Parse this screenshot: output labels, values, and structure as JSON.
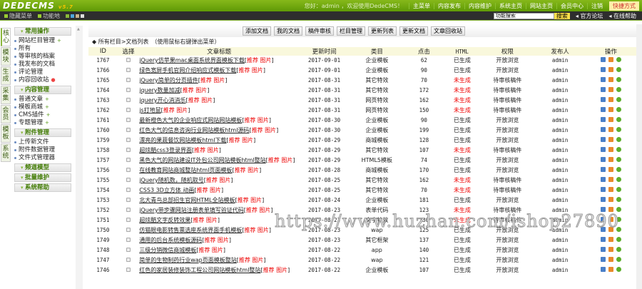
{
  "header": {
    "logo": "DEDECMS",
    "version": "v5.7",
    "welcome": "您好：admin ，欢迎使用DedeCMS！",
    "nav": [
      "主菜单",
      "内容发布",
      "内容维护",
      "系统主页",
      "网站主页",
      "会员中心",
      "注销"
    ],
    "quick": "快捷方式"
  },
  "bar": {
    "hide_menu": "隐藏菜单",
    "func_map": "功能地",
    "search_value": "功能搜索",
    "search_btn": "搜索",
    "forum": "官方论坛",
    "help": "在线帮助",
    "skin_colors": [
      "#8ab83a",
      "#4ea6dc",
      "#c9b28a",
      "#dddddd"
    ]
  },
  "vtabs": [
    "核心",
    "模块",
    "生成",
    "采集",
    "会员",
    "模板",
    "系统"
  ],
  "menu": {
    "g1": "常用操作",
    "g1_items": [
      "网站栏目管理",
      "所有",
      "等审核的档案",
      "我发布的文档",
      "评论管理",
      "内容回收站"
    ],
    "g2": "内容管理",
    "g2_items": [
      "普通文章",
      "模板商城",
      "CMS插件",
      "专题管理"
    ],
    "g3": "附件管理",
    "g3_items": [
      "上传新文件",
      "附件数据管理",
      "文件式管理器"
    ],
    "g4": "频道模型",
    "g5": "批量维护",
    "g6": "系统帮助"
  },
  "toolbar": [
    "添加文档",
    "我的文档",
    "稿件审核",
    "栏目管理",
    "更新列表",
    "更新文档",
    "文章回收站"
  ],
  "crumb": "所有栏目>文档列表　（使用鼠标右键弹出菜单）",
  "columns": [
    "ID",
    "选择",
    "文章标题",
    "更新时间",
    "类目",
    "点击",
    "HTML",
    "权限",
    "发布人",
    "操作"
  ],
  "tags": {
    "open": "[",
    "rec": "推荐",
    "pic": "图片",
    "close": "]"
  },
  "rows": [
    [
      "1767",
      "jQuery仿苹果mac桌面系统界面模板下载",
      "2017-09-01",
      "企业模板",
      "62",
      "已生成",
      "开放浏览",
      "admin"
    ],
    [
      "1766",
      "绿色宽屏手机官网介绍响应式模板下载",
      "2017-09-01",
      "企业模板",
      "90",
      "已生成",
      "开放浏览",
      "admin"
    ],
    [
      "1765",
      "jQuery简单的分页插件",
      "2017-08-31",
      "其它特效",
      "70",
      "未生成",
      "待审核稿件",
      "admin"
    ],
    [
      "1764",
      "jquery数量加减",
      "2017-08-31",
      "其它特效",
      "172",
      "未生成",
      "待审核稿件",
      "admin"
    ],
    [
      "1763",
      "jquery开心消消乐",
      "2017-08-31",
      "网页特效",
      "162",
      "未生成",
      "待审核稿件",
      "admin"
    ],
    [
      "1762",
      "js打地鼠",
      "2017-08-31",
      "网页特效",
      "150",
      "未生成",
      "待审核稿件",
      "admin"
    ],
    [
      "1761",
      "最新橙色大气的企业响应式网站网站模板",
      "2017-08-30",
      "企业模板",
      "90",
      "已生成",
      "开放浏览",
      "admin"
    ],
    [
      "1760",
      "红色大气的信息咨询行业网站模板html源码",
      "2017-08-30",
      "企业模板",
      "199",
      "已生成",
      "开放浏览",
      "admin"
    ],
    [
      "1759",
      "漂亮的果蔬餐饮网站模板html下载",
      "2017-08-29",
      "商城模板",
      "128",
      "已生成",
      "开放浏览",
      "admin"
    ],
    [
      "1758",
      "超炫酷css3登录界面",
      "2017-08-29",
      "其它特效",
      "107",
      "未生成",
      "待审核稿件",
      "admin"
    ],
    [
      "1757",
      "黑色大气的网站建设IT外包公司网站模板html整站",
      "2017-08-29",
      "HTML5模板",
      "74",
      "已生成",
      "开放浏览",
      "admin"
    ],
    [
      "1756",
      "在线教育网站商城整站html页面模板",
      "2017-08-28",
      "商城模板",
      "170",
      "已生成",
      "开放浏览",
      "admin"
    ],
    [
      "1755",
      "jQuery随机数，随机取号",
      "2017-08-25",
      "其它特效",
      "162",
      "未生成",
      "待审核稿件",
      "admin"
    ],
    [
      "1754",
      "CSS3 3D立方体 动画",
      "2017-08-25",
      "其它特效",
      "70",
      "未生成",
      "待审核稿件",
      "admin"
    ],
    [
      "1753",
      "北大青鸟总部招生官网HTML全站模板",
      "2017-08-24",
      "企业模板",
      "181",
      "已生成",
      "开放浏览",
      "admin"
    ],
    [
      "1752",
      "jQuery带步骤网站注册表单填写验证代码",
      "2017-08-23",
      "表单代码",
      "123",
      "未生成",
      "待审核稿件",
      "admin"
    ],
    [
      "1751",
      "超炫酷文字反转效果",
      "2017-08-23",
      "文字特效",
      "130",
      "未生成",
      "待审核稿件",
      "admin"
    ],
    [
      "1750",
      "仿猫眼电影转售票选座系统界面手机模板",
      "2017-08-23",
      "wap",
      "125",
      "已生成",
      "开放浏览",
      "admin"
    ],
    [
      "1749",
      "通用的后台系统模板源码",
      "2017-08-23",
      "其它框架",
      "137",
      "已生成",
      "开放浏览",
      "admin"
    ],
    [
      "1748",
      "三级分销微信商城模板",
      "2017-08-22",
      "app",
      "140",
      "已生成",
      "开放浏览",
      "admin"
    ],
    [
      "1747",
      "简单的生物制药行业wap页面模板整站",
      "2017-08-22",
      "wap",
      "121",
      "已生成",
      "开放浏览",
      "admin"
    ],
    [
      "1746",
      "红色的家居装修装饰工程公司网站模板html整站",
      "2017-08-22",
      "企业模板",
      "107",
      "已生成",
      "开放浏览",
      "admin"
    ]
  ],
  "watermark": "https://www.huzhan.com/ishop27890"
}
